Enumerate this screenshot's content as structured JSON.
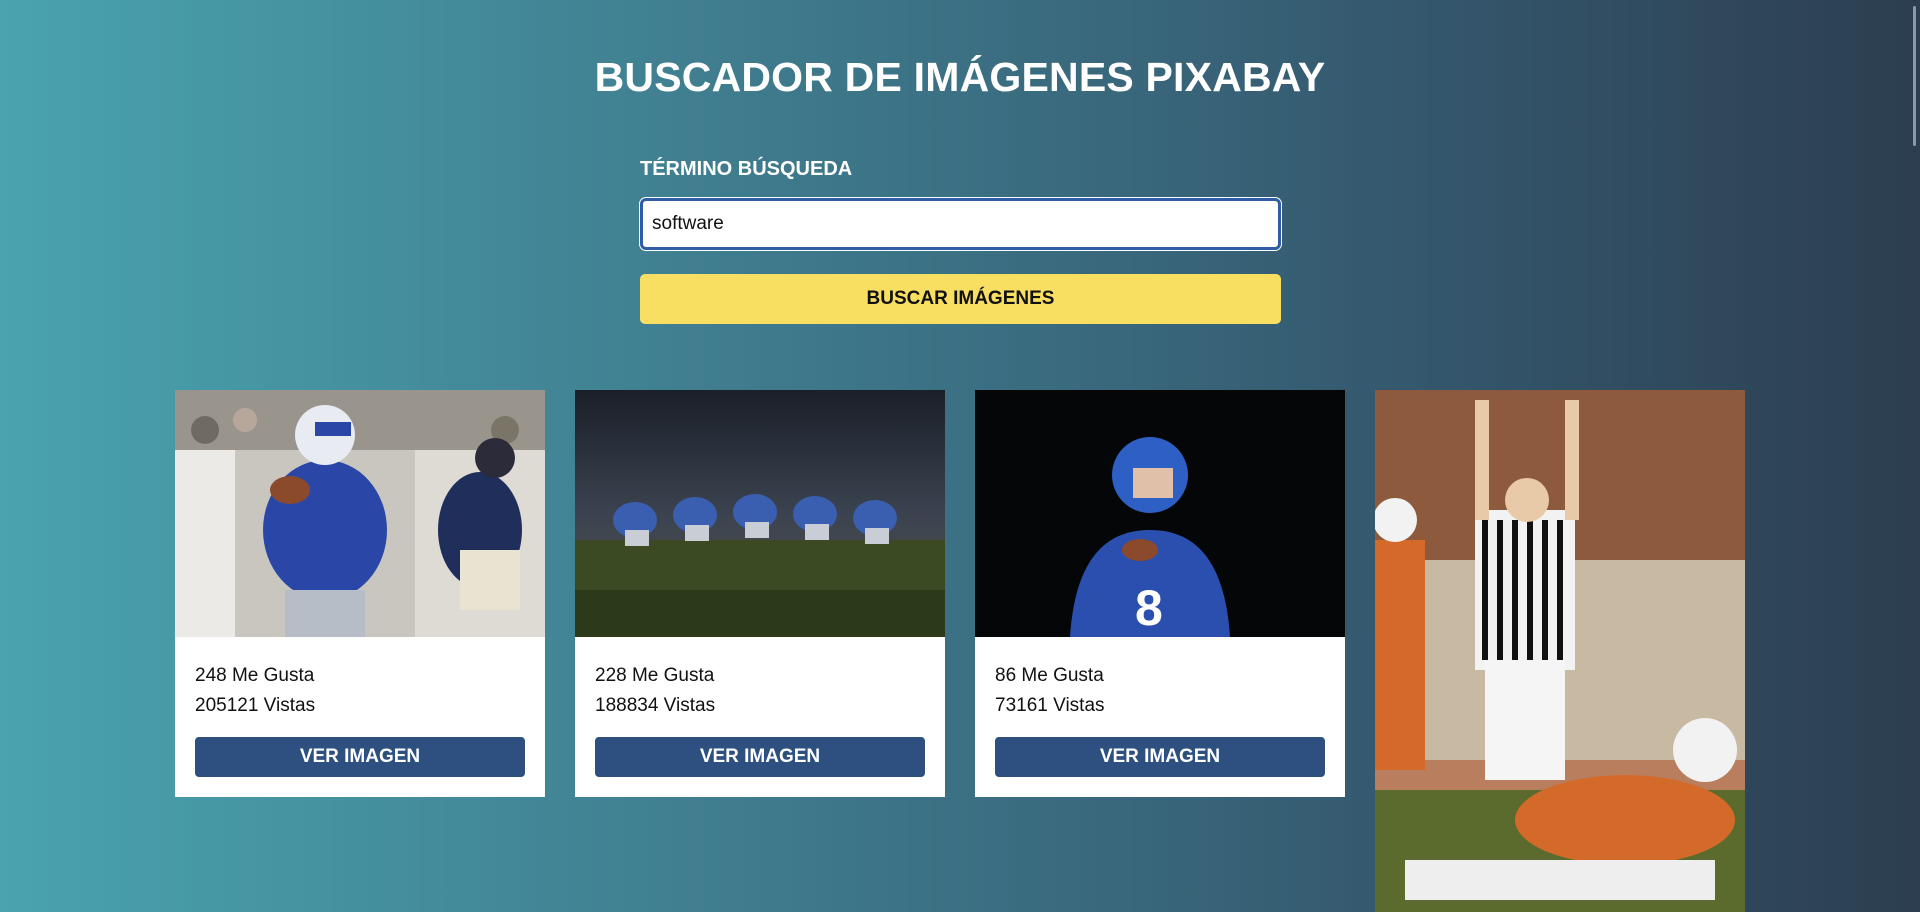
{
  "header": {
    "title": "BUSCADOR DE IMÁGENES PIXABAY"
  },
  "search": {
    "label": "TÉRMINO BÚSQUEDA",
    "value": "software",
    "button_label": "BUSCAR IMÁGENES"
  },
  "results": [
    {
      "likes": "248 Me Gusta",
      "views": "205121 Vistas",
      "button_label": "VER IMAGEN",
      "image": "football-quarterback-photo"
    },
    {
      "likes": "228 Me Gusta",
      "views": "188834 Vistas",
      "button_label": "VER IMAGEN",
      "image": "football-linemen-night-photo"
    },
    {
      "likes": "86 Me Gusta",
      "views": "73161 Vistas",
      "button_label": "VER IMAGEN",
      "image": "football-player-dark-photo"
    },
    {
      "image": "football-referee-touchdown-photo"
    }
  ],
  "colors": {
    "background_start": "#4aa3af",
    "background_end": "#2c3e50",
    "search_button": "#f8df62",
    "view_button": "#2d5080"
  }
}
